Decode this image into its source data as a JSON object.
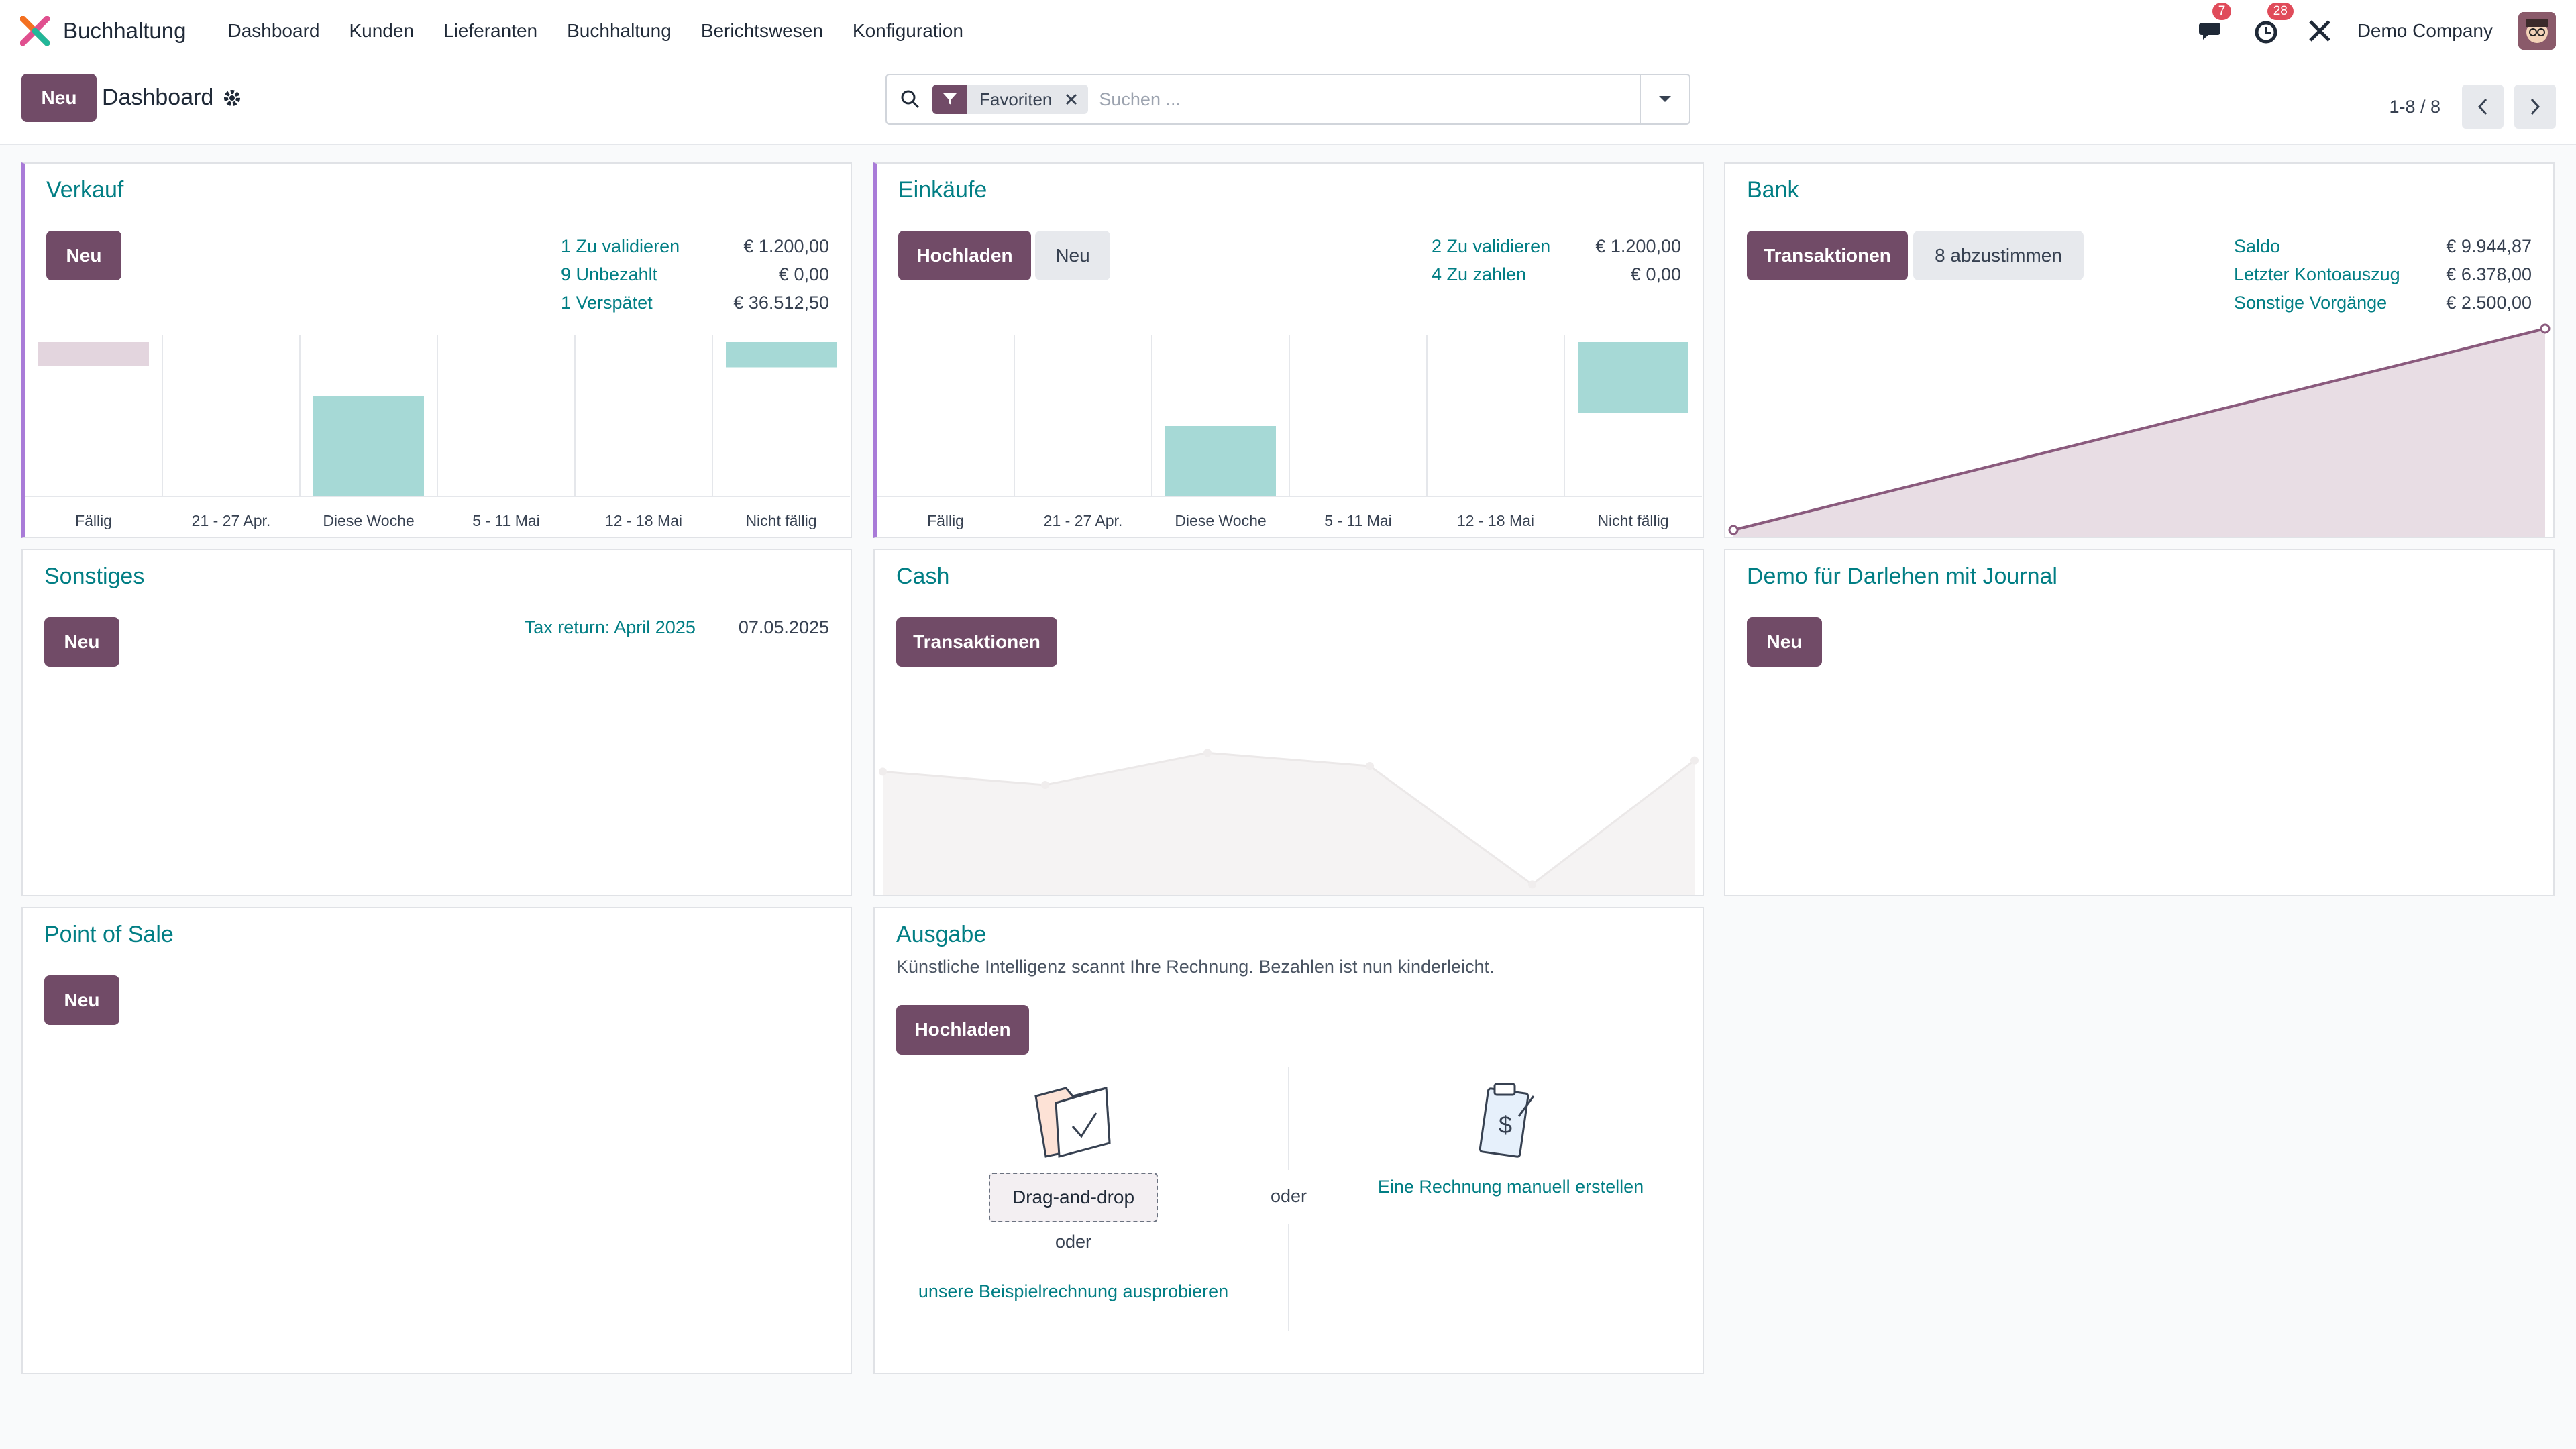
{
  "nav": {
    "app_name": "Buchhaltung",
    "menu": [
      "Dashboard",
      "Kunden",
      "Lieferanten",
      "Buchhaltung",
      "Berichtswesen",
      "Konfiguration"
    ],
    "messages_count": "7",
    "activities_count": "28",
    "company": "Demo Company"
  },
  "control": {
    "new_label": "Neu",
    "breadcrumb": "Dashboard",
    "facet": "Favoriten",
    "search_placeholder": "Suchen ...",
    "pager": "1-8 / 8"
  },
  "colors": {
    "primary": "#714b67",
    "link": "#017e84",
    "accent_border": "#a97bd8",
    "bar_teal": "#a6d9d6",
    "bar_pink": "#e3d5de"
  },
  "cards": {
    "verkauf": {
      "title": "Verkauf",
      "new": "Neu",
      "stats": [
        {
          "label": "1 Zu validieren",
          "value": "€ 1.200,00"
        },
        {
          "label": "9 Unbezahlt",
          "value": "€ 0,00"
        },
        {
          "label": "1 Verspätet",
          "value": "€ 36.512,50"
        }
      ]
    },
    "einkaeufe": {
      "title": "Einkäufe",
      "upload": "Hochladen",
      "new": "Neu",
      "stats": [
        {
          "label": "2 Zu validieren",
          "value": "€ 1.200,00"
        },
        {
          "label": "4 Zu zahlen",
          "value": "€ 0,00"
        }
      ]
    },
    "bank": {
      "title": "Bank",
      "transactions": "Transaktionen",
      "reconcile": "8 abzustimmen",
      "stats": [
        {
          "label": "Saldo",
          "value": "€ 9.944,87"
        },
        {
          "label": "Letzter Kontoauszug",
          "value": "€ 6.378,00"
        },
        {
          "label": "Sonstige Vorgänge",
          "value": "€ 2.500,00"
        }
      ]
    },
    "sonstiges": {
      "title": "Sonstiges",
      "new": "Neu",
      "item_label": "Tax return: April 2025",
      "item_date": "07.05.2025"
    },
    "cash": {
      "title": "Cash",
      "transactions": "Transaktionen"
    },
    "darlehen": {
      "title": "Demo für Darlehen mit Journal",
      "new": "Neu"
    },
    "pos": {
      "title": "Point of Sale",
      "new": "Neu"
    },
    "ausgabe": {
      "title": "Ausgabe",
      "subtitle": "Künstliche Intelligenz scannt Ihre Rechnung. Bezahlen ist nun kinderleicht.",
      "upload": "Hochladen",
      "dragdrop": "Drag-and-drop",
      "or1": "oder",
      "or2": "oder",
      "sample": "unsere Beispielrechnung ausprobieren",
      "manual": "Eine Rechnung manuell erstellen"
    }
  },
  "chart_data": [
    {
      "type": "bar",
      "name": "verkauf",
      "categories": [
        "Fällig",
        "21 - 27 Apr.",
        "Diese Woche",
        "5 - 11 Mai",
        "12 - 18 Mai",
        "Nicht fällig"
      ],
      "values": [
        0.24,
        0,
        1.0,
        0,
        0,
        0.25
      ],
      "colors": [
        "pink",
        "",
        "teal",
        "",
        "",
        "teal"
      ]
    },
    {
      "type": "bar",
      "name": "einkaeufe",
      "categories": [
        "Fällig",
        "21 - 27 Apr.",
        "Diese Woche",
        "5 - 11 Mai",
        "12 - 18 Mai",
        "Nicht fällig"
      ],
      "values": [
        0,
        0,
        0.7,
        0,
        0,
        0.7
      ]
    },
    {
      "type": "area",
      "name": "bank",
      "values": [
        0,
        1
      ]
    },
    {
      "type": "area",
      "name": "cash",
      "values": [
        0.62,
        0.55,
        0.72,
        0.65,
        0.02,
        0.68
      ]
    }
  ]
}
